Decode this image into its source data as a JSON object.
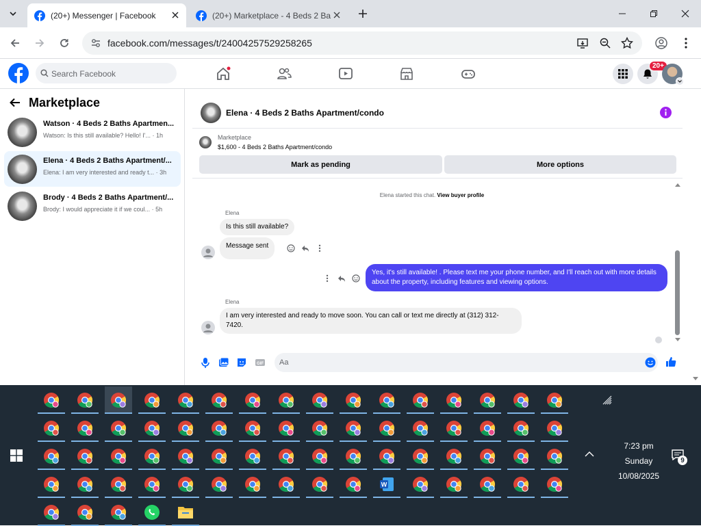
{
  "browser": {
    "tabs": [
      {
        "title": "(20+) Messenger | Facebook",
        "active": true
      },
      {
        "title": "(20+) Marketplace - 4 Beds 2 Ba",
        "active": false
      }
    ],
    "url": "facebook.com/messages/t/24004257529258265"
  },
  "fb": {
    "search_placeholder": "Search Facebook",
    "notification_badge": "20+"
  },
  "sidebar": {
    "title": "Marketplace",
    "conversations": [
      {
        "name": "Watson · 4 Beds 2 Baths Apartmen...",
        "preview": "Watson: Is this still available? Hello! I'...",
        "time": "· 1h"
      },
      {
        "name": "Elena · 4 Beds 2 Baths Apartment/...",
        "preview": "Elena: I am very interested and ready t...",
        "time": "· 3h"
      },
      {
        "name": "Brody · 4 Beds 2 Baths Apartment/...",
        "preview": "Brody: I would appreciate it if we coul...",
        "time": "· 5h"
      }
    ]
  },
  "chat": {
    "title": "Elena · 4 Beds 2 Baths Apartment/condo",
    "marketplace_label": "Marketplace",
    "listing": "$1,600 - 4 Beds 2 Baths Apartment/condo",
    "mark_pending": "Mark as pending",
    "more_options": "More options",
    "system_text": "Elena started this chat.",
    "system_link": "View buyer profile",
    "messages": [
      {
        "sender": "Elena",
        "text": "Is this still available?"
      },
      {
        "text": "Message sent"
      },
      {
        "text": "Yes, it's still available! . Please text me your phone number, and I'll reach out with more details about the property, including features and viewing options."
      },
      {
        "sender": "Elena",
        "text": "I am very interested and ready to move soon. You can call or text me directly at (312) 312-7420."
      }
    ],
    "composer_placeholder": "Aa"
  },
  "taskbar": {
    "time": "7:23 pm",
    "day": "Sunday",
    "date": "10/08/2025",
    "notifications": "9"
  },
  "colors": {
    "fb_blue": "#0866ff",
    "my_bubble": "#4e45f2",
    "taskbar": "#1f2b36"
  }
}
